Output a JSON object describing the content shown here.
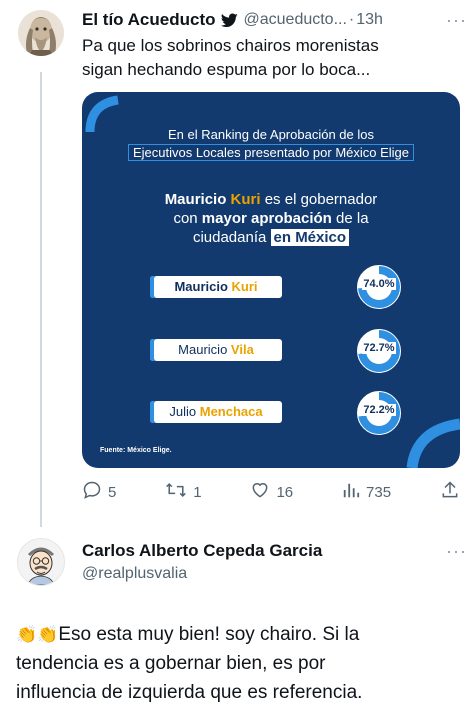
{
  "tweet1": {
    "display_name": "El tío Acueducto",
    "handle": "@acueducto...",
    "separator": "·",
    "time": "13h",
    "more": "···",
    "text_line1": "Pa que los sobrinos chairos morenistas",
    "text_line2": "sigan hechando espuma por lo boca...",
    "card": {
      "header_line1": "En el Ranking de Aprobación de los",
      "header_line2": "Ejecutivos Locales presentado por México Elige",
      "headline_line1_a": "Mauricio ",
      "headline_line1_b": "Kuri",
      "headline_line1_c": " es el gobernador",
      "headline_line2_a": "con ",
      "headline_line2_b": "mayor aprobación",
      "headline_line2_c": " de la",
      "headline_line3_a": "ciudadanía ",
      "headline_line3_b": "en México",
      "rows": [
        {
          "first": "Mauricio ",
          "last": "Kuri",
          "pct_label": "74.0%",
          "pct": 0.74
        },
        {
          "first": "Mauricio ",
          "last": "Vila",
          "pct_label": "72.7%",
          "pct": 0.727
        },
        {
          "first": "Julio ",
          "last": "Menchaca",
          "pct_label": "72.2%",
          "pct": 0.722
        }
      ],
      "source": "Fuente: México Elige."
    },
    "actions": {
      "replies": "5",
      "retweets": "1",
      "likes": "16",
      "views": "735"
    }
  },
  "tweet2": {
    "display_name": "Carlos Alberto Cepeda Garcia",
    "handle": "@realplusvalia",
    "more": "···",
    "emoji": "👏👏",
    "text_line1": "Eso esta muy bien! soy chairo.  Si la",
    "text_line2": "tendencia es a gobernar bien, es por",
    "text_line3": "influencia de izquierda que es referencia."
  },
  "colors": {
    "card_bg": "#123a6e",
    "accent_blue": "#2f8fe0",
    "accent_yellow": "#e9a300",
    "twitter_blue": "#1d9bf0"
  },
  "icons": [
    "verified-bird-icon",
    "reply-icon",
    "retweet-icon",
    "like-icon",
    "views-icon",
    "share-icon"
  ]
}
